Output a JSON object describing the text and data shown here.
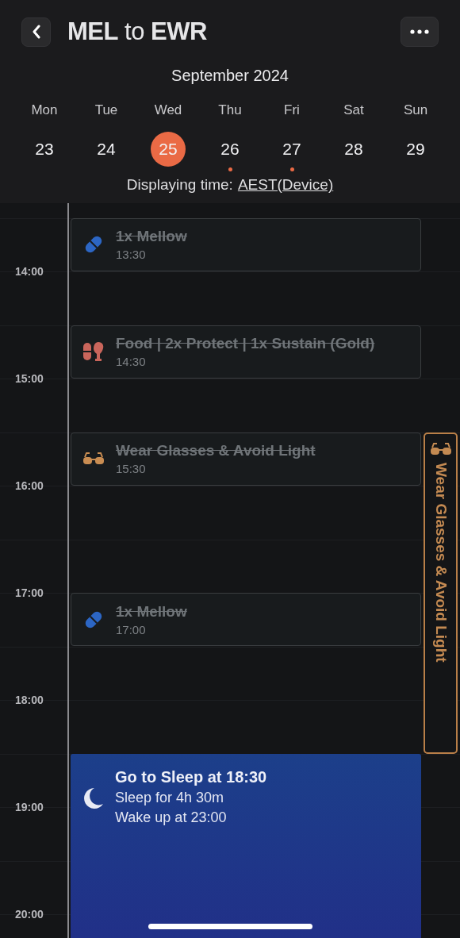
{
  "header": {
    "title": "**MEL** to **EWR**"
  },
  "calendar": {
    "month": "September 2024",
    "days": [
      {
        "weekday": "Mon",
        "date": "23",
        "selected": false,
        "has_events": false
      },
      {
        "weekday": "Tue",
        "date": "24",
        "selected": false,
        "has_events": false
      },
      {
        "weekday": "Wed",
        "date": "25",
        "selected": true,
        "has_events": false
      },
      {
        "weekday": "Thu",
        "date": "26",
        "selected": false,
        "has_events": true
      },
      {
        "weekday": "Fri",
        "date": "27",
        "selected": false,
        "has_events": true
      },
      {
        "weekday": "Sat",
        "date": "28",
        "selected": false,
        "has_events": false
      },
      {
        "weekday": "Sun",
        "date": "29",
        "selected": false,
        "has_events": false
      }
    ],
    "timezone_label": "Displaying time:",
    "timezone_link": "AEST(Device)"
  },
  "timeline": {
    "hours": [
      "14:00",
      "15:00",
      "16:00",
      "17:00",
      "18:00",
      "19:00",
      "20:00"
    ],
    "events": [
      {
        "kind": "pill",
        "title": "1x Mellow",
        "time": "13:30",
        "done": true
      },
      {
        "kind": "food",
        "title": "Food | 2x Protect | 1x Sustain (Gold)",
        "time": "14:30",
        "done": true
      },
      {
        "kind": "glasses",
        "title": "Wear Glasses & Avoid Light",
        "time": "15:30",
        "done": true
      },
      {
        "kind": "pill",
        "title": "1x Mellow",
        "time": "17:00",
        "done": true
      }
    ],
    "span": {
      "kind": "glasses",
      "label": "Wear Glasses & Avoid Light"
    },
    "sleep": {
      "title": "Go to Sleep at 18:30",
      "duration": "Sleep for 4h 30m",
      "wake": "Wake up at 23:00"
    }
  }
}
